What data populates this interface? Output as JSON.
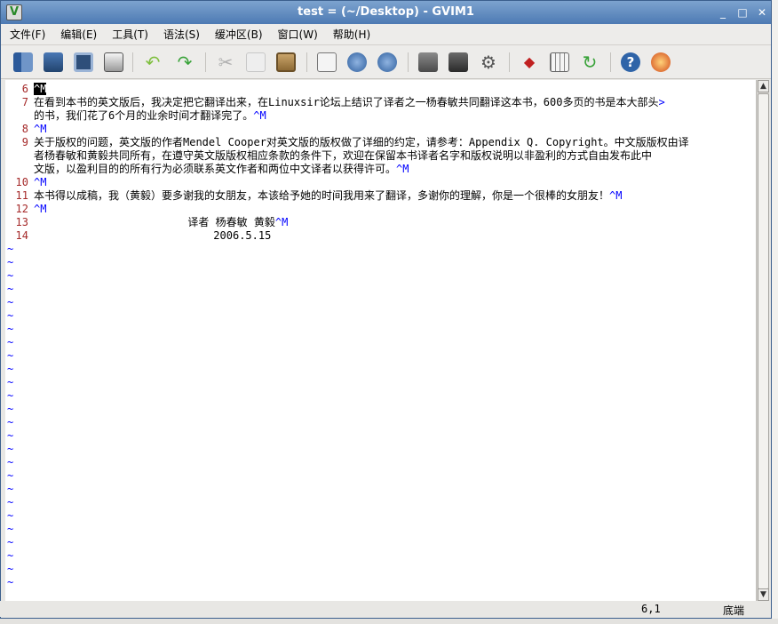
{
  "window": {
    "title": "test = (~/Desktop) - GVIM1",
    "minimize": "_",
    "maximize": "□",
    "close": "✕"
  },
  "menu": [
    {
      "label": "文件(F)"
    },
    {
      "label": "编辑(E)"
    },
    {
      "label": "工具(T)"
    },
    {
      "label": "语法(S)"
    },
    {
      "label": "缓冲区(B)"
    },
    {
      "label": "窗口(W)"
    },
    {
      "label": "帮助(H)"
    }
  ],
  "toolbar_icons": [
    "open-icon",
    "save-to-icon",
    "save-icon",
    "print-icon",
    "undo-icon",
    "redo-icon",
    "cut-icon",
    "copy-icon",
    "paste-icon",
    "find-replace-icon",
    "find-next-icon",
    "find-prev-icon",
    "load-session-icon",
    "save-session-icon",
    "run-script-icon",
    "make-icon",
    "run-ctags-icon",
    "jump-tag-icon",
    "help-icon",
    "find-help-icon"
  ],
  "colors": {
    "line_number": "#a52a2a",
    "ctrl_char": "#0000ff",
    "tilde": "#0000ff"
  },
  "editor": {
    "lines": [
      {
        "num": "6",
        "text": "",
        "ctrl": "^M"
      },
      {
        "num": "7",
        "text": "在看到本书的英文版后，我决定把它翻译出来，在Linuxsir论坛上结识了译者之一杨春敏共同翻译这本书，600多页的书是本大部头",
        "ctrl": ">"
      },
      {
        "num": "",
        "text": "的书，我们花了6个月的业余时间才翻译完了。",
        "ctrl": "^M"
      },
      {
        "num": "8",
        "text": "",
        "ctrl": "^M"
      },
      {
        "num": "9",
        "text": "关于版权的问题，英文版的作者Mendel Cooper对英文版的版权做了详细的约定，请参考：Appendix Q. Copyright。中文版版权由译",
        "ctrl": ""
      },
      {
        "num": "",
        "text": "者杨春敏和黄毅共同所有，在遵守英文版版权相应条款的条件下，欢迎在保留本书译者名字和版权说明以非盈利的方式自由发布此中",
        "ctrl": ""
      },
      {
        "num": "",
        "text": "文版，以盈利目的的所有行为必须联系英文作者和两位中文译者以获得许可。",
        "ctrl": "^M"
      },
      {
        "num": "10",
        "text": "",
        "ctrl": "^M"
      },
      {
        "num": "11",
        "text": "本书得以成稿，我（黄毅）要多谢我的女朋友，本该给予她的时间我用来了翻译，多谢你的理解，你是一个很棒的女朋友！",
        "ctrl": "^M"
      },
      {
        "num": "12",
        "text": "",
        "ctrl": "^M"
      },
      {
        "num": "13",
        "text": "                        译者 杨春敏 黄毅",
        "ctrl": "^M"
      },
      {
        "num": "14",
        "text": "                            2006.5.15",
        "ctrl": ""
      }
    ],
    "tilde": "~"
  },
  "status": {
    "position": "6,1",
    "scroll": "底端"
  },
  "scrollbar": {
    "up": "▲",
    "down": "▼"
  }
}
